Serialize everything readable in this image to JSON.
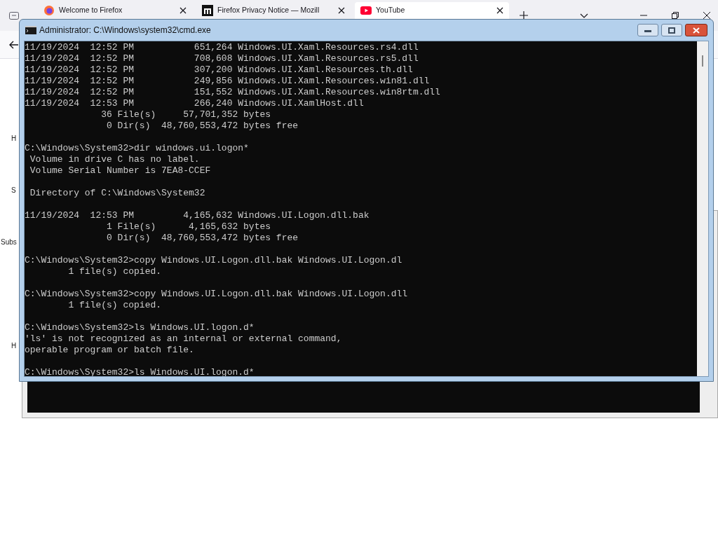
{
  "browser": {
    "tabs": [
      {
        "title": "Welcome to Firefox",
        "kind": "firefox",
        "selected": false
      },
      {
        "title": "Firefox Privacy Notice — Mozill",
        "kind": "mozilla",
        "selected": false
      },
      {
        "title": "YouTube",
        "kind": "youtube",
        "selected": true
      }
    ],
    "page_fragments": [
      "H",
      "S",
      "Subs",
      "H"
    ]
  },
  "console_window": {
    "title": "Administrator: C:\\Windows\\system32\\cmd.exe",
    "blocks": [
      [
        "11/19/2024  12:52 PM           651,264 Windows.UI.Xaml.Resources.rs4.dll",
        "11/19/2024  12:52 PM           708,608 Windows.UI.Xaml.Resources.rs5.dll",
        "11/19/2024  12:52 PM           307,200 Windows.UI.Xaml.Resources.th.dll",
        "11/19/2024  12:52 PM           249,856 Windows.UI.Xaml.Resources.win81.dll",
        "11/19/2024  12:52 PM           151,552 Windows.UI.Xaml.Resources.win8rtm.dll",
        "11/19/2024  12:53 PM           266,240 Windows.UI.XamlHost.dll",
        "              36 File(s)     57,701,352 bytes",
        "               0 Dir(s)  48,760,553,472 bytes free"
      ],
      [
        "C:\\Windows\\System32>dir windows.ui.logon*",
        " Volume in drive C has no label.",
        " Volume Serial Number is 7EA8-CCEF"
      ],
      [
        " Directory of C:\\Windows\\System32"
      ],
      [
        "11/19/2024  12:53 PM         4,165,632 Windows.UI.Logon.dll.bak",
        "               1 File(s)      4,165,632 bytes",
        "               0 Dir(s)  48,760,553,472 bytes free"
      ],
      [
        "C:\\Windows\\System32>copy Windows.UI.Logon.dll.bak Windows.UI.Logon.dl",
        "        1 file(s) copied."
      ],
      [
        "C:\\Windows\\System32>copy Windows.UI.Logon.dll.bak Windows.UI.Logon.dll",
        "        1 file(s) copied."
      ],
      [
        "C:\\Windows\\System32>ls Windows.UI.logon.d*",
        "'ls' is not recognized as an internal or external command,",
        "operable program or batch file."
      ],
      [
        "C:\\Windows\\System32>ls Windows.UI.logon.d*"
      ]
    ]
  }
}
